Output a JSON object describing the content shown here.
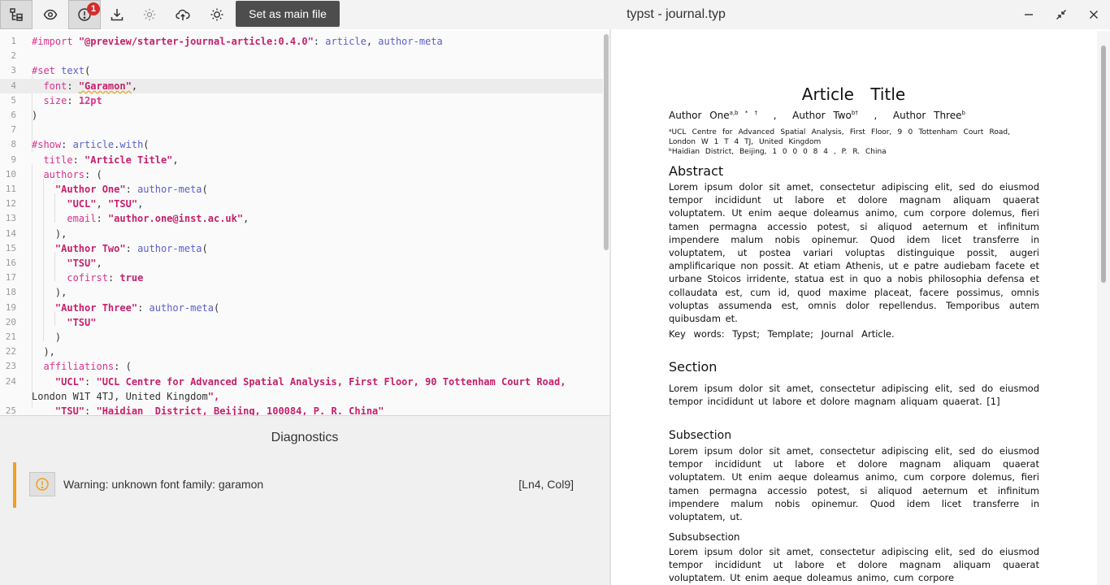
{
  "toolbar": {
    "buttons": [
      {
        "name": "outline-icon",
        "active": true
      },
      {
        "name": "eye-icon"
      },
      {
        "name": "diagnostics-icon"
      },
      {
        "name": "download-icon"
      },
      {
        "name": "gear-icon"
      },
      {
        "name": "cloud-upload-icon"
      },
      {
        "name": "sun-icon"
      }
    ],
    "diagnostics_count": "1",
    "main_file_label": "Set as main file"
  },
  "window": {
    "title": "typst - journal.typ"
  },
  "editor": {
    "line_numbers": [
      "1",
      "2",
      "3",
      "4",
      "5",
      "6",
      "7",
      "8",
      "9",
      "10",
      "11",
      "12",
      "13",
      "14",
      "15",
      "16",
      "17",
      "18",
      "19",
      "20",
      "21",
      "22",
      "23",
      "24",
      "",
      "25"
    ],
    "current_line": "4",
    "lines": [
      "#import \"@preview/starter-journal-article:0.4.0\": article, author-meta",
      "",
      "#set text(",
      "  font: \"Garamon\",",
      "  size: 12pt",
      ")",
      "",
      "#show: article.with(",
      "  title: \"Article Title\",",
      "  authors: (",
      "    \"Author One\": author-meta(",
      "      \"UCL\", \"TSU\",",
      "      email: \"author.one@inst.ac.uk\",",
      "    ),",
      "    \"Author Two\": author-meta(",
      "      \"TSU\",",
      "      cofirst: true",
      "    ),",
      "    \"Author Three\": author-meta(",
      "      \"TSU\"",
      "    )",
      "  ),",
      "  affiliations: (",
      "    \"UCL\": \"UCL Centre for Advanced Spatial Analysis, First Floor, 90 Tottenham Court Road,",
      "London W1T 4TJ, United Kingdom\",",
      "    \"TSU\": \"Haidian  District, Beijing, 100084, P. R. China\""
    ]
  },
  "diagnostics": {
    "title": "Diagnostics",
    "items": [
      {
        "severity": "warning",
        "message": "Warning: unknown font family: garamon",
        "location": "[Ln4, Col9]"
      }
    ]
  },
  "preview": {
    "title": "Article Title",
    "authors": [
      {
        "name": "Author One",
        "marks": "a,b * †"
      },
      {
        "name": "Author Two",
        "marks": "b†"
      },
      {
        "name": "Author Three",
        "marks": "b"
      }
    ],
    "affiliations": [
      "ᵃUCL Centre for Advanced Spatial Analysis, First Floor, 9 0 Tottenham Court Road, London W 1 T 4 TJ, United Kingdom",
      "ᵇHaidian District, Beijing, 1 0 0 0 8 4 , P. R. China"
    ],
    "abstract_heading": "Abstract",
    "abstract_text": "Lorem ipsum dolor sit amet, consectetur adipiscing elit, sed do eiusmod tempor incididunt ut labore et dolore magnam aliquam quaerat voluptatem. Ut enim aeque doleamus animo, cum corpore dolemus, fieri tamen permagna accessio potest, si aliquod aeternum et infinitum impendere malum nobis opinemur. Quod idem licet transferre in voluptatem, ut postea variari voluptas distinguique possit, augeri amplificarique non possit. At etiam Athenis, ut e patre audiebam facete et urbane Stoicos irridente, statua est in quo a nobis philosophia defensa et collaudata est, cum id, quod maxime placeat, facere possimus, omnis voluptas assumenda est, omnis dolor repellendus. Temporibus autem quibusdam et.",
    "keywords": "Key words: Typst; Template; Journal Article.",
    "section_heading": "Section",
    "section_text": "Lorem ipsum dolor sit amet, consectetur adipiscing elit, sed do eiusmod tempor incididunt ut labore et dolore magnam aliquam quaerat. [1]",
    "subsection_heading": "Subsection",
    "subsection_text": "Lorem ipsum dolor sit amet, consectetur adipiscing elit, sed do eiusmod tempor incididunt ut labore et dolore magnam aliquam quaerat voluptatem. Ut enim aeque doleamus animo, cum corpore dolemus, fieri tamen permagna accessio potest, si aliquod aeternum et infinitum impendere malum nobis opinemur. Quod idem licet transferre in voluptatem, ut.",
    "subsubsection_heading": "Subsubsection",
    "subsubsection_text": "Lorem ipsum dolor sit amet, consectetur adipiscing elit, sed do eiusmod tempor incididunt ut labore et dolore magnam aliquam quaerat voluptatem. Ut enim aeque doleamus animo, cum corpore"
  },
  "colors": {
    "keyword": "#d7338e",
    "string": "#c51f6a",
    "function": "#5b5fc7",
    "warning": "#f0a020",
    "badge": "#d62b2b"
  }
}
